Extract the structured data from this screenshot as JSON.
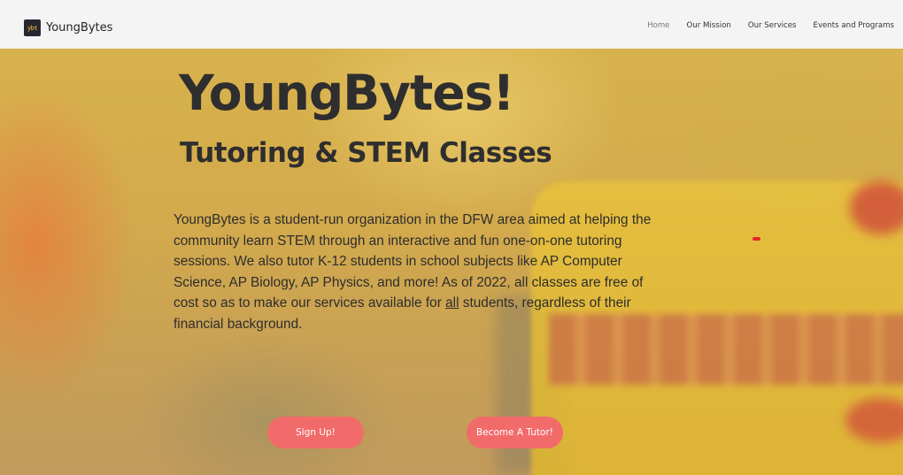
{
  "header": {
    "logo_mark": "ybt",
    "brand": "YoungBytes",
    "nav": [
      {
        "label": "Home",
        "active": true
      },
      {
        "label": "Our Mission",
        "active": false
      },
      {
        "label": "Our Services",
        "active": false
      },
      {
        "label": "Events and Programs",
        "active": false
      }
    ]
  },
  "hero": {
    "title": "YoungBytes!",
    "subtitle": "Tutoring & STEM Classes",
    "description_before": "YoungBytes is a student-run organization in the DFW area aimed at helping the community learn STEM through an interactive and fun one-on-one tutoring sessions. We also tutor K-12 students in school subjects like AP Computer Science, AP Biology, AP Physics, and more! As of 2022, all classes are free of cost so as to make our services available for ",
    "description_emphasis": "all",
    "description_after": " students, regardless of their financial background.",
    "buttons": {
      "signup": "Sign Up!",
      "tutor": "Become A Tutor!"
    }
  },
  "colors": {
    "button": "#f26b6b",
    "text": "#2e2e2e",
    "header_bg": "#f4f4f4"
  }
}
